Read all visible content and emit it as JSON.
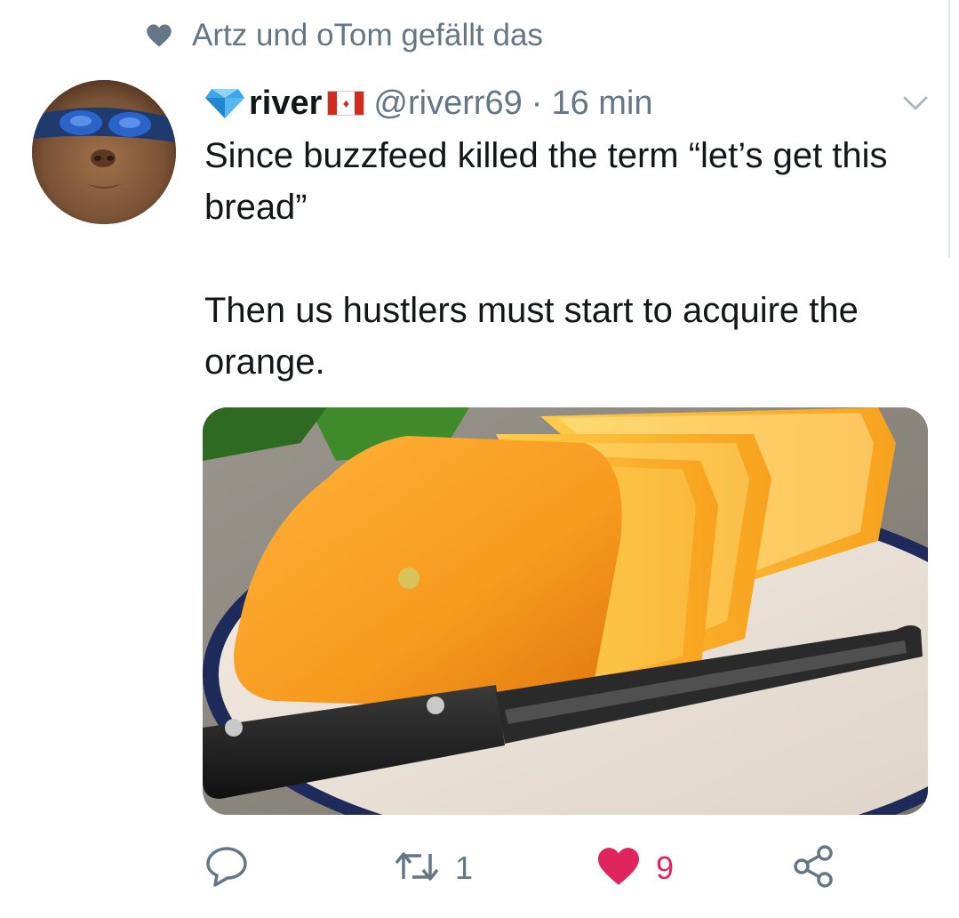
{
  "social_context": {
    "text": "Artz und oTom gefällt das",
    "icon": "heart-icon",
    "color": "#657786"
  },
  "tweet": {
    "display_name": "river",
    "flag_icon": "canada-flag-icon",
    "verified_icon": "diamond-icon",
    "handle": "@riverr69",
    "separator": "·",
    "timestamp": "16 min",
    "text_paragraphs": [
      "Since buzzfeed killed the term “let’s get this bread”",
      "Then us hustlers must start to acquire the orange."
    ],
    "media_description_icon": "square-orange-photo"
  },
  "actions": {
    "reply": {
      "icon": "reply-icon",
      "count": ""
    },
    "retweet": {
      "icon": "retweet-icon",
      "count": "1"
    },
    "like": {
      "icon": "heart-filled-icon",
      "count": "9",
      "color": "#e0245e"
    },
    "share": {
      "icon": "share-icon"
    }
  },
  "colors": {
    "secondary_text": "#657786",
    "primary_text": "#14171a",
    "like_red": "#e0245e",
    "verified_blue": "#3ea6e8"
  }
}
